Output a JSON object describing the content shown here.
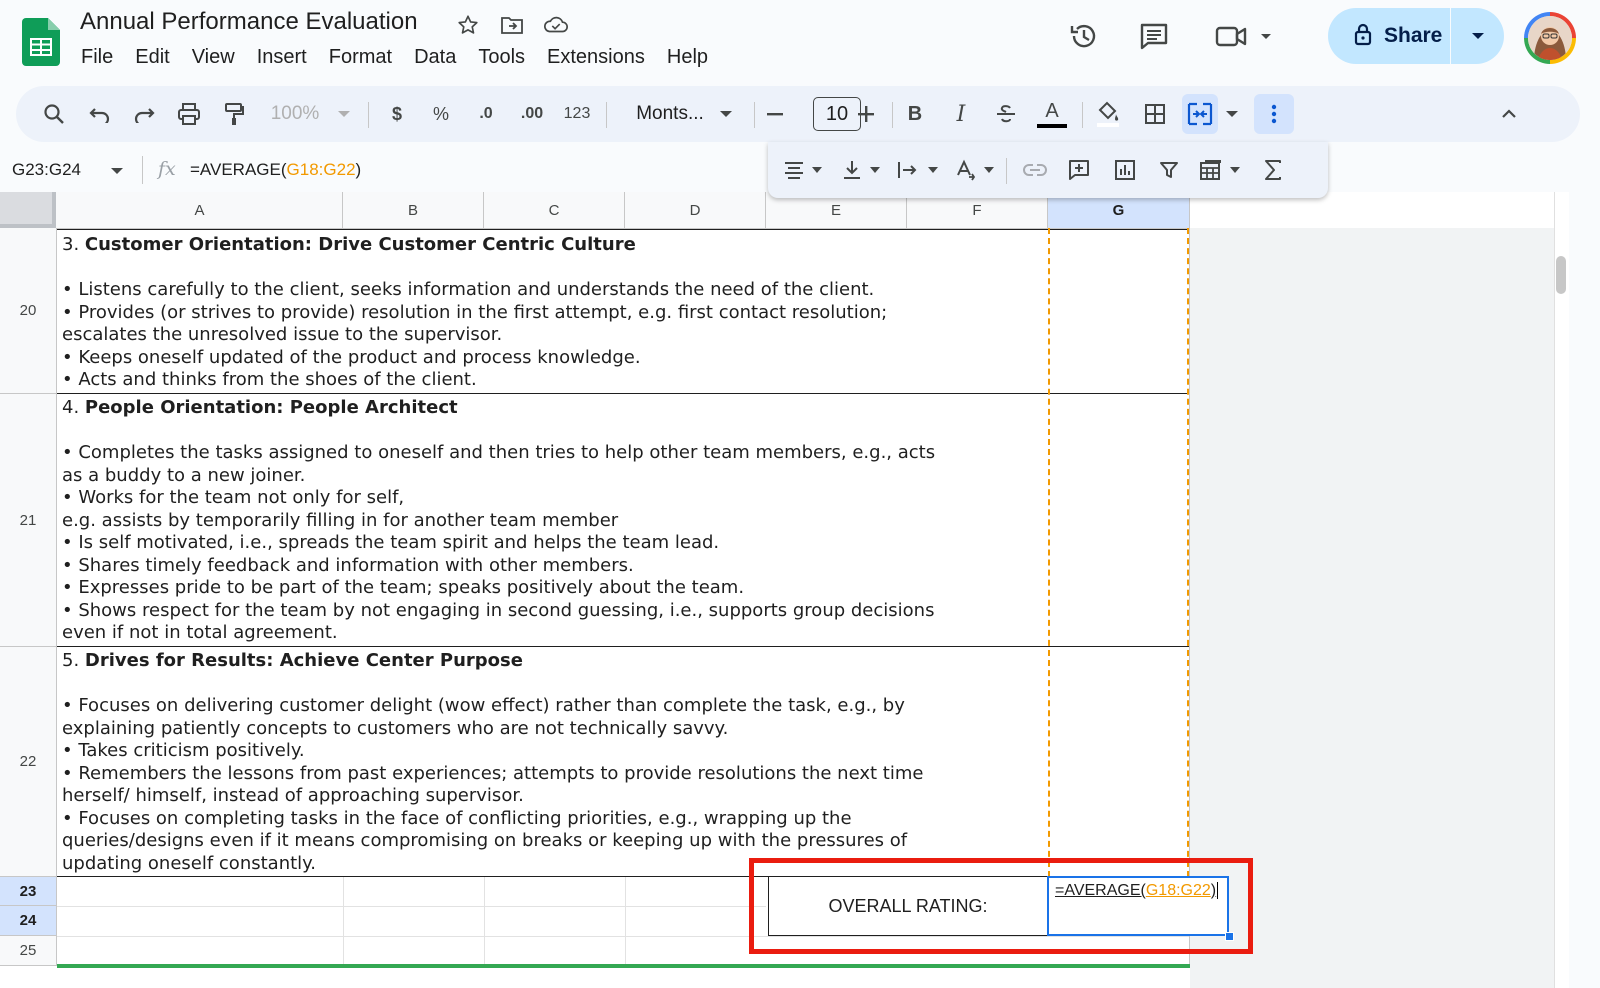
{
  "app": {
    "doc_title": "Annual Performance Evaluation",
    "menu": [
      "File",
      "Edit",
      "View",
      "Insert",
      "Format",
      "Data",
      "Tools",
      "Extensions",
      "Help"
    ],
    "share_label": "Share"
  },
  "toolbar": {
    "zoom": "100%",
    "currency": "$",
    "percent": "%",
    "decrease_decimal": ".0",
    "increase_decimal": ".00",
    "number_format": "123",
    "font_name": "Monts...",
    "font_size": "10",
    "bold": "B",
    "italic": "I",
    "text_color_letter": "A"
  },
  "formula_bar": {
    "name_box": "G23:G24",
    "fx": "fx",
    "formula_prefix": "=AVERAGE(",
    "formula_range": "G18:G22",
    "formula_suffix": ")"
  },
  "columns": [
    "A",
    "B",
    "C",
    "D",
    "E",
    "F",
    "G"
  ],
  "rows": [
    {
      "number": "20",
      "heading_num": "3. ",
      "heading": "Customer Orientation: Drive Customer Centric Culture",
      "lines": [
        "• Listens carefully to the client, seeks information and understands the need of the client.",
        "• Provides (or strives to provide) resolution in the first attempt, e.g. first contact resolution;",
        "escalates the unresolved issue to the supervisor.",
        "• Keeps oneself updated of the product and process knowledge.",
        "• Acts and thinks from the shoes of the client."
      ]
    },
    {
      "number": "21",
      "heading_num": "4. ",
      "heading": "People Orientation: People Architect",
      "lines": [
        "• Completes the tasks assigned to oneself and then tries to help other team members, e.g., acts",
        "as a buddy to a new joiner.",
        "• Works for the team not only for self,",
        "e.g. assists by temporarily filling in for another team member",
        "• Is self motivated, i.e., spreads the team spirit and helps the team lead.",
        "• Shares timely feedback and information with other members.",
        "• Expresses pride to be part of the team; speaks positively about the team.",
        "• Shows respect for the team by not engaging in second guessing, i.e., supports group decisions",
        "even if not in total agreement."
      ]
    },
    {
      "number": "22",
      "heading_num": "5. ",
      "heading": "Drives for Results: Achieve Center Purpose",
      "lines": [
        "• Focuses on delivering customer delight (wow effect) rather than complete the task, e.g., by",
        "explaining patiently concepts to customers who are not technically savvy.",
        "• Takes criticism positively.",
        "• Remembers the lessons from past experiences; attempts to provide resolutions the next time",
        "herself/ himself, instead of approaching supervisor.",
        "• Focuses on completing tasks in the face of conflicting priorities, e.g., wrapping up the",
        "queries/designs even if it means compromising on breaks or keeping up with the pressures of",
        "updating oneself constantly."
      ]
    }
  ],
  "small_rows": [
    "23",
    "24",
    "25"
  ],
  "overall_rating_label": "OVERALL RATING:",
  "colors": {
    "accent": "#1a73e8",
    "share_bg": "#c2e7ff",
    "highlight_red": "#ea1c0f",
    "range_orange": "#f29900",
    "sheets_green": "#0f9d58"
  }
}
